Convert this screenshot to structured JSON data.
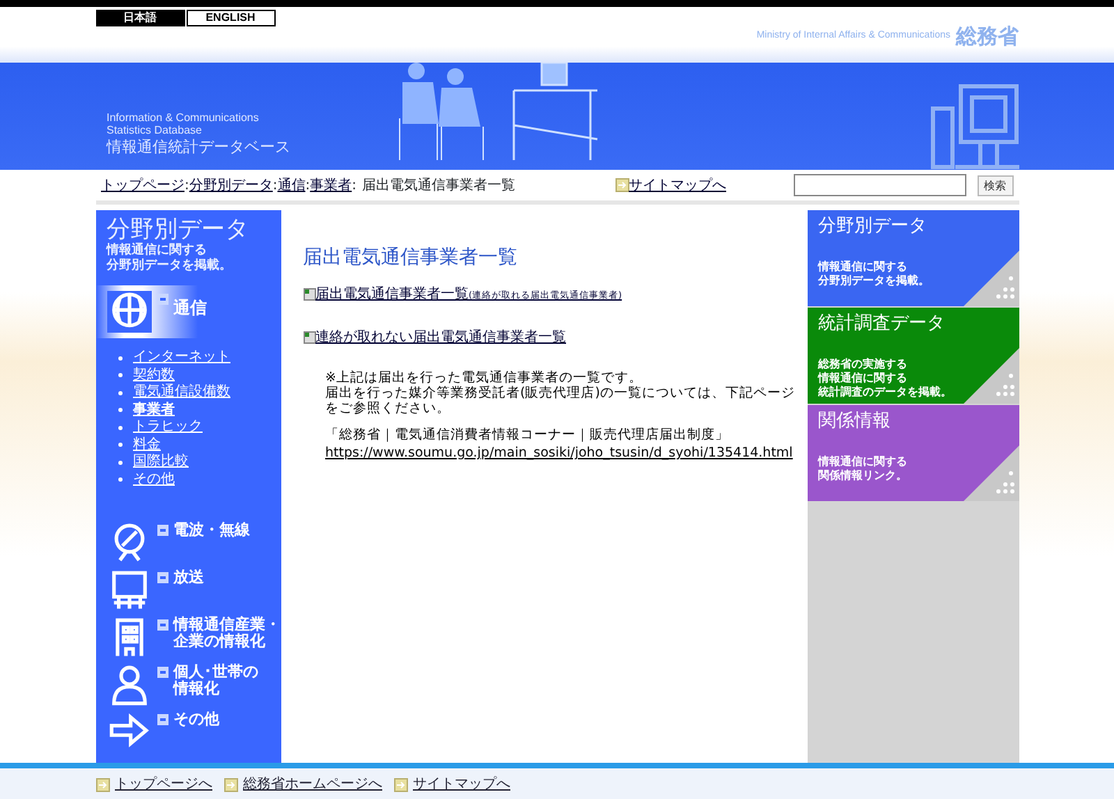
{
  "language_tabs": [
    {
      "label": "日本語",
      "selected": true
    },
    {
      "label": "ENGLISH",
      "selected": false
    }
  ],
  "header": {
    "ministry_en": "Ministry of Internal Affairs  & Communications",
    "ministry_ja": "総務省",
    "db_en_1": "Information & Communications",
    "db_en_2": "Statistics Database",
    "db_title": "情報通信統計データベース"
  },
  "breadcrumb": {
    "separator": ":",
    "items": [
      {
        "label": "トップページ",
        "link": true
      },
      {
        "label": "分野別データ",
        "link": true
      },
      {
        "label": "通信",
        "link": true
      },
      {
        "label": "事業者",
        "link": true
      },
      {
        "label": "届出電気通信事業者一覧",
        "link": false
      }
    ]
  },
  "sitemap_link": "サイトマップへ",
  "search": {
    "button": "検索"
  },
  "sidebar": {
    "heading": "分野別データ",
    "subtitle_lines": [
      "情報通信に関する",
      "分野別データを掲載。"
    ],
    "categories": [
      {
        "lines": [
          "通信"
        ],
        "kind": "globe",
        "selected": true,
        "children": [
          {
            "label": "インターネット",
            "selected": false
          },
          {
            "label": "契約数",
            "selected": false
          },
          {
            "label": "電気通信設備数",
            "selected": false
          },
          {
            "label": "事業者",
            "selected": true
          },
          {
            "label": "トラヒック",
            "selected": false
          },
          {
            "label": "料金",
            "selected": false
          },
          {
            "label": "国際比較",
            "selected": false
          },
          {
            "label": "その他",
            "selected": false
          }
        ]
      },
      {
        "lines": [
          "電波・無線"
        ],
        "kind": "dish",
        "selected": false
      },
      {
        "lines": [
          "放送"
        ],
        "kind": "screen",
        "selected": false
      },
      {
        "lines": [
          "情報通信産業・",
          "企業の情報化"
        ],
        "kind": "building",
        "selected": false
      },
      {
        "lines": [
          "個人･世帯の",
          "情報化"
        ],
        "kind": "person",
        "selected": false
      },
      {
        "lines": [
          "その他"
        ],
        "kind": "arrow",
        "selected": false
      }
    ]
  },
  "main": {
    "title": "届出電気通信事業者一覧",
    "links": [
      {
        "label": "届出電気通信事業者一覧",
        "note": "(連絡が取れる届出電気通信事業者)"
      },
      {
        "label": "連絡が取れない届出電気通信事業者一覧"
      }
    ],
    "notice": [
      "※上記は届出を行った電気通信事業者の一覧です。",
      "届出を行った媒介等業務受託者(販売代理店)の一覧については、下記ページをご参照ください。"
    ],
    "reference": "「総務省｜電気通信消費者情報コーナー｜販売代理店届出制度」",
    "url": "https://www.soumu.go.jp/main_sosiki/joho_tsusin/d_syohi/135414.html"
  },
  "banners": [
    {
      "title": "分野別データ",
      "description": [
        "情報通信に関する",
        "分野別データを掲載。"
      ],
      "color": "#3a66f2"
    },
    {
      "title": "統計調査データ",
      "description": [
        "総務省の実施する",
        "情報通信に関する",
        "統計調査のデータを掲載。"
      ],
      "color": "#0a8a0a"
    },
    {
      "title": "関係情報",
      "description": [
        "情報通信に関する",
        "関係情報リンク。"
      ],
      "color": "#9a56cc"
    }
  ],
  "footer_links": [
    "トップページへ",
    "総務省ホームページへ",
    "サイトマップへ"
  ]
}
